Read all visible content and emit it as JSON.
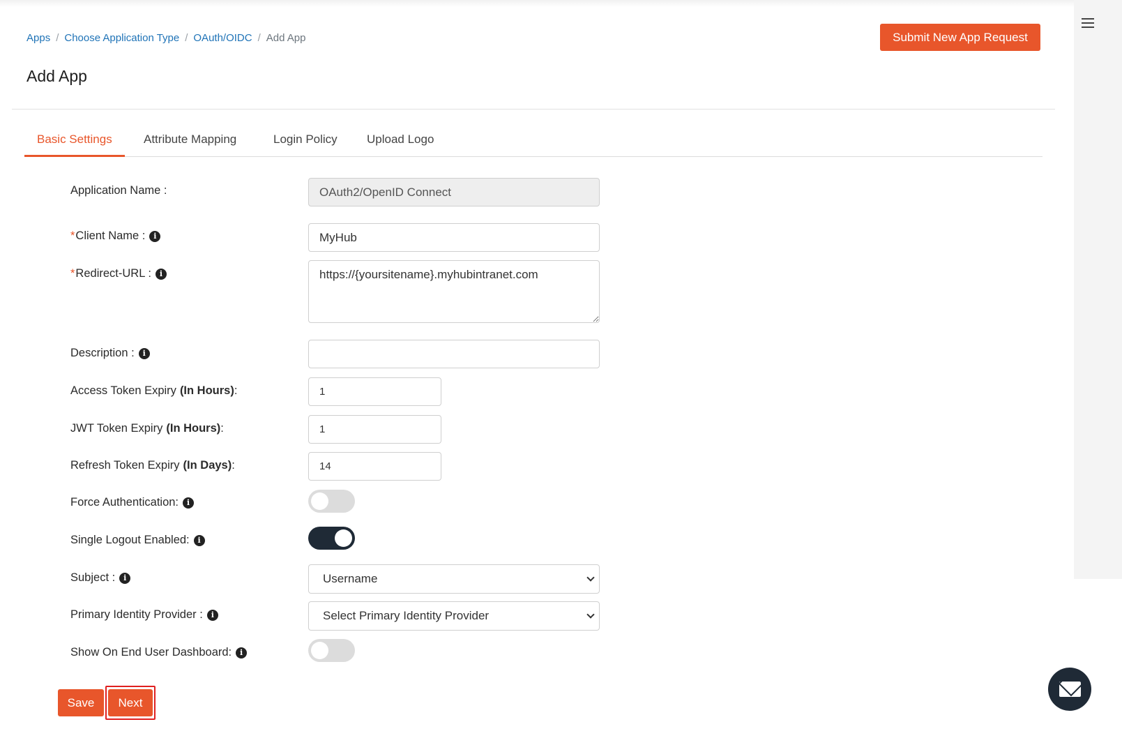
{
  "breadcrumb": {
    "items": [
      "Apps",
      "Choose Application Type",
      "OAuth/OIDC"
    ],
    "current": "Add App",
    "separator": "/"
  },
  "header": {
    "submit_label": "Submit New App Request",
    "title": "Add App"
  },
  "tabs": [
    "Basic Settings",
    "Attribute Mapping",
    "Login Policy",
    "Upload Logo"
  ],
  "form": {
    "application_name": {
      "label": "Application Name :",
      "value": "OAuth2/OpenID Connect"
    },
    "client_name": {
      "required": "*",
      "label": "Client Name :",
      "value": "MyHub"
    },
    "redirect_url": {
      "required": "*",
      "label": "Redirect-URL :",
      "value": "https://{yoursitename}.myhubintranet.com"
    },
    "description": {
      "label": "Description :",
      "value": ""
    },
    "access_token_expiry": {
      "label": "Access Token Expiry",
      "unit": "(In Hours)",
      "suffix": ":",
      "value": "1"
    },
    "jwt_token_expiry": {
      "label": "JWT Token Expiry",
      "unit": "(In Hours)",
      "suffix": ":",
      "value": "1"
    },
    "refresh_token_expiry": {
      "label": "Refresh Token Expiry",
      "unit": "(In Days)",
      "suffix": ":",
      "value": "14"
    },
    "force_authentication": {
      "label": "Force Authentication:",
      "enabled": false
    },
    "single_logout": {
      "label": "Single Logout Enabled:",
      "enabled": true
    },
    "subject": {
      "label": "Subject :",
      "selected": "Username"
    },
    "primary_idp": {
      "label": "Primary Identity Provider :",
      "selected": "Select Primary Identity Provider"
    },
    "show_on_dashboard": {
      "label": "Show On End User Dashboard:",
      "enabled": false
    }
  },
  "actions": {
    "save_label": "Save",
    "next_label": "Next"
  },
  "icons": {
    "info": "info-icon",
    "glyph": "i",
    "chat": "envelope-icon",
    "menu": "hamburger-icon"
  },
  "colors": {
    "accent": "#e8562b",
    "link": "#1f73b7",
    "toggle_on": "#1f2a36",
    "highlight": "#e02020"
  }
}
